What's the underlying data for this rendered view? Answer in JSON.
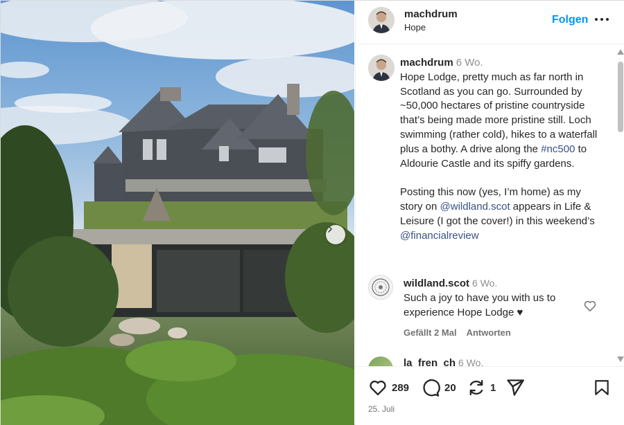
{
  "post": {
    "username": "machdrum",
    "location": "Hope",
    "follow_label": "Folgen",
    "date": "25. Juli"
  },
  "caption": {
    "username": "machdrum",
    "time": "6 Wo.",
    "text_1": "Hope Lodge, pretty much as far north in Scotland as you can go. Surrounded by ~50,000 hectares of pristine countryside that’s being made more pristine still. Loch swimming (rather cold), hikes to a waterfall plus a bothy. A drive along the ",
    "hashtag": "#nc500",
    "text_2": " to Aldourie Castle and its spiffy gardens.",
    "text_3": "Posting this now (yes, I’m home) as my story on ",
    "mention_1": "@wildland.scot",
    "text_4": " appears in Life & Leisure (I got the cover!) in this weekend’s ",
    "mention_2": "@financialreview"
  },
  "comments": [
    {
      "username": "wildland.scot",
      "time": "6 Wo.",
      "text": "Such a joy to have you with us to experience Hope Lodge ♥",
      "likes_label": "Gefällt 2 Mal",
      "reply_label": "Antworten"
    },
    {
      "username": "la_fren_ch",
      "time": "6 Wo."
    }
  ],
  "stats": {
    "likes": "289",
    "comments": "20",
    "reposts": "1"
  },
  "icons": {
    "like": "heart-icon",
    "comment": "comment-bubble-icon",
    "repost": "repost-icon",
    "share": "send-icon",
    "save": "bookmark-icon",
    "more": "more-dots-icon",
    "next": "chevron-right-icon"
  },
  "colors": {
    "accent": "#0095f6",
    "link": "#385185",
    "muted": "#737373"
  }
}
